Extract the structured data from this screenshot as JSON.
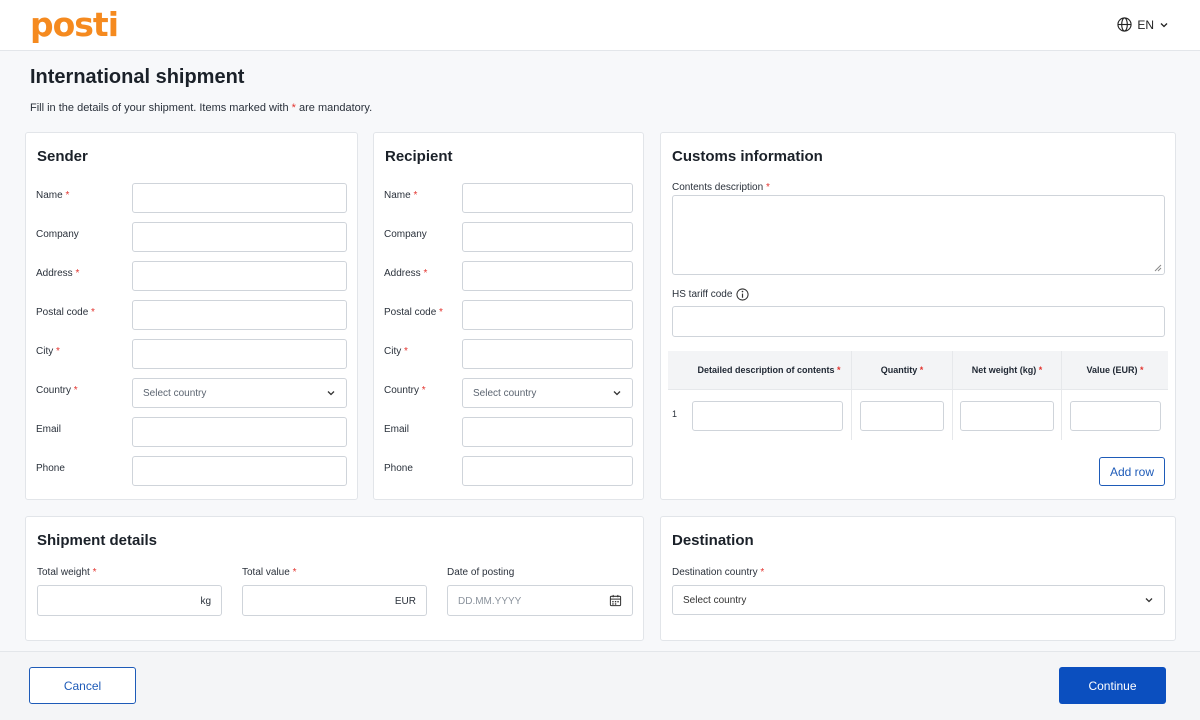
{
  "header": {
    "logo_text": "posti",
    "language": "EN",
    "brand_color": "#f58a1f",
    "language_icon": "globe-icon"
  },
  "page": {
    "title": "International shipment",
    "intro_before": "Fill in the details of your shipment. Items marked with ",
    "required_marker": "*",
    "intro_after": " are mandatory."
  },
  "sender": {
    "title": "Sender",
    "name_label": "Name",
    "company_label": "Company",
    "address_label": "Address",
    "postal_label": "Postal code",
    "city_label": "City",
    "country_label": "Country",
    "country_placeholder": "Select country",
    "email_label": "Email",
    "phone_label": "Phone"
  },
  "recipient": {
    "title": "Recipient",
    "name_label": "Name",
    "company_label": "Company",
    "address_label": "Address",
    "postal_label": "Postal code",
    "city_label": "City",
    "country_label": "Country",
    "country_placeholder": "Select country",
    "email_label": "Email",
    "phone_label": "Phone"
  },
  "customs": {
    "title": "Customs information",
    "contents_label": "Contents description",
    "hs_label": "HS tariff code",
    "table": {
      "col_description": "Detailed description of contents",
      "col_quantity": "Quantity",
      "col_weight": "Net weight (kg)",
      "col_value": "Value (EUR)",
      "row_number": "1"
    },
    "add_row_label": "Add row"
  },
  "shipment": {
    "title": "Shipment details",
    "weight_label": "Total weight",
    "weight_unit": "kg",
    "value_label": "Total value",
    "value_unit": "EUR",
    "date_label": "Date of posting",
    "date_placeholder": "DD.MM.YYYY"
  },
  "destination": {
    "title": "Destination",
    "country_label": "Destination country",
    "country_placeholder": "Select country"
  },
  "footer": {
    "cancel_label": "Cancel",
    "continue_label": "Continue",
    "primary_color": "#0b4fbf"
  }
}
